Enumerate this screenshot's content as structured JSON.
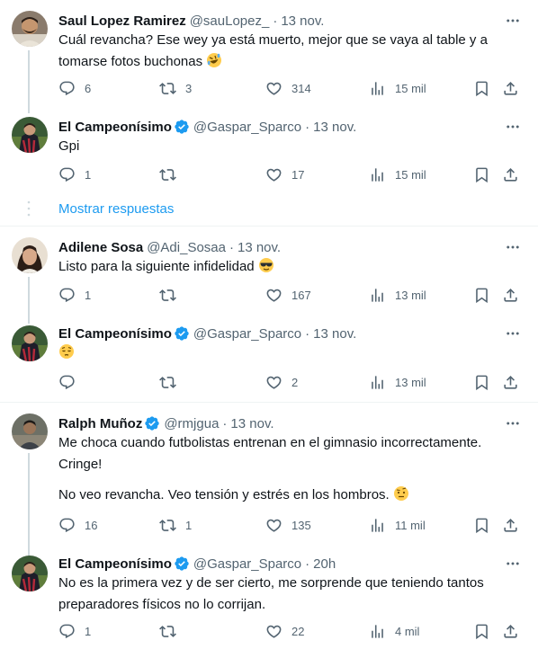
{
  "tweets": [
    {
      "name": "Saul Lopez Ramirez",
      "verified": false,
      "handle": "@sauLopez_",
      "time": "13 nov.",
      "text": "Cuál revancha? Ese wey ya está muerto, mejor que se vaya al table y a tomarse fotos buchonas ",
      "emoji": "rolling-laughing-emoji",
      "stats": {
        "replies": "6",
        "retweets": "3",
        "likes": "314",
        "views": "15 mil"
      }
    },
    {
      "name": "El Campeonísimo",
      "verified": true,
      "handle": "@Gaspar_Sparco",
      "time": "13 nov.",
      "text": "Gpi",
      "stats": {
        "replies": "1",
        "retweets": "",
        "likes": "17",
        "views": "15 mil"
      }
    },
    {
      "name": "Adilene Sosa",
      "verified": false,
      "handle": "@Adi_Sosaa",
      "time": "13 nov.",
      "text": "Listo para la siguiente infidelidad ",
      "emoji": "sunglasses-emoji",
      "stats": {
        "replies": "1",
        "retweets": "",
        "likes": "167",
        "views": "13 mil"
      }
    },
    {
      "name": "El Campeonísimo",
      "verified": true,
      "handle": "@Gaspar_Sparco",
      "time": "13 nov.",
      "text": "",
      "emoji": "pensive-emoji",
      "stats": {
        "replies": "",
        "retweets": "",
        "likes": "2",
        "views": "13 mil"
      }
    },
    {
      "name": "Ralph Muñoz",
      "verified": true,
      "handle": "@rmjgua",
      "time": "13 nov.",
      "text": "Me choca cuando futbolistas entrenan en el gimnasio incorrectamente. Cringe!",
      "text2": "No veo revancha. Veo tensión y estrés en los hombros. ",
      "emoji": "raised-eyebrow-emoji",
      "stats": {
        "replies": "16",
        "retweets": "1",
        "likes": "135",
        "views": "11 mil"
      }
    },
    {
      "name": "El Campeonísimo",
      "verified": true,
      "handle": "@Gaspar_Sparco",
      "time": "20h",
      "text": "No es la primera vez y de ser cierto, me sorprende que teniendo tantos preparadores físicos no lo corrijan.",
      "stats": {
        "replies": "1",
        "retweets": "",
        "likes": "22",
        "views": "4 mil"
      }
    }
  ],
  "show_replies_label": "Mostrar respuestas",
  "colors": {
    "text": "#0f1419",
    "secondary": "#536471",
    "accent": "#1d9bf0",
    "divider": "#eff3f4"
  }
}
